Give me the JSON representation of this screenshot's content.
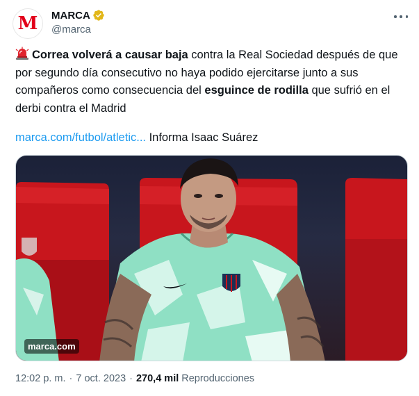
{
  "account": {
    "avatar_letter": "M",
    "display_name": "MARCA",
    "handle": "@marca",
    "verified_badge": "gold-verified-checkmark",
    "brand_color": "#e2001a"
  },
  "tweet": {
    "emoji": "police-car-light-icon",
    "bold_1": "Correa volverá a causar baja",
    "text_1": " contra la Real Sociedad después de que por segundo día consecutivo no haya podido ejercitarse junto a sus compañeros como consecuencia del ",
    "bold_2": "esguince de rodilla",
    "text_2": " que sufrió en el derbi contra el Madrid",
    "link_text": "marca.com/futbol/atletic...",
    "link_suffix": " Informa Isaac Suárez"
  },
  "media": {
    "watermark": "marca.com"
  },
  "meta": {
    "time": "12:02 p. m.",
    "separator": "·",
    "date": "7 oct. 2023",
    "views_count": "270,4 mil",
    "views_label": "Reproducciones"
  },
  "colors": {
    "link": "#1d9bf0",
    "secondary_text": "#536471",
    "verified_gold": "#e2b719",
    "seat_red": "#c8161d",
    "shirt_mint": "#8fe0c4"
  }
}
